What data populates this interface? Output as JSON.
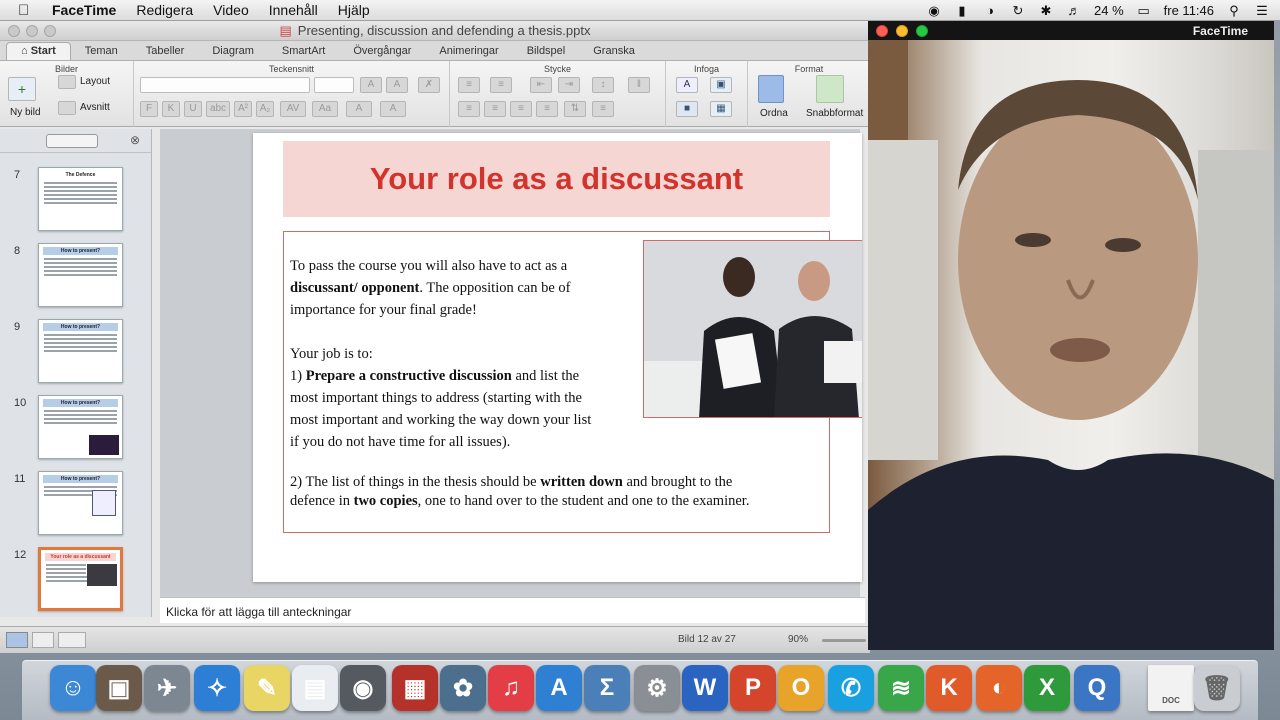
{
  "menubar": {
    "app_name": "FaceTime",
    "items": [
      "Redigera",
      "Video",
      "Innehåll",
      "Hjälp"
    ],
    "battery": "24 %",
    "clock": "fre 11:46"
  },
  "ppt": {
    "window_title": "Presenting, discussion and defending a thesis.pptx",
    "tabs": [
      "Start",
      "Teman",
      "Tabeller",
      "Diagram",
      "SmartArt",
      "Övergångar",
      "Animeringar",
      "Bildspel",
      "Granska"
    ],
    "ribbon": {
      "groups": [
        "Bilder",
        "Teckensnitt",
        "Stycke",
        "Infoga",
        "Format"
      ],
      "new_slide": "Ny bild",
      "layout": "Layout",
      "section": "Avsnitt",
      "arrange": "Ordna",
      "quick_styles": "Snabbformat"
    },
    "thumbnails": [
      {
        "num": "7",
        "title": "The Defence"
      },
      {
        "num": "8",
        "title": "How to present?"
      },
      {
        "num": "9",
        "title": "How to present?"
      },
      {
        "num": "10",
        "title": "How to present?"
      },
      {
        "num": "11",
        "title": "How to present?"
      },
      {
        "num": "12",
        "title": "Your role as a discussant"
      }
    ],
    "slide": {
      "title": "Your role as a discussant",
      "p1_a": "To pass the course you will also have to act as a",
      "p1_b": "discussant/ opponent",
      "p1_c": ". The opposition can be of",
      "p1_d": "importance for your final grade!",
      "p2": "Your job is to:",
      "p3_a": "1) ",
      "p3_b": "Prepare a constructive discussion",
      "p3_c": " and list the",
      "p3_d": "most important things to address (starting with the",
      "p3_e": "most important and working the way down your list",
      "p3_f": "if you do not have time for all issues).",
      "p4_a": "2) The list of things in the thesis should be ",
      "p4_b": "written down",
      "p4_c": " and brought to the",
      "p4_d": "defence in ",
      "p4_e": "two copies",
      "p4_f": ", one to hand over to the student and one to the examiner."
    },
    "notes_placeholder": "Klicka för att lägga till anteckningar",
    "status_slide": "Bild 12 av 27",
    "zoom": "90%"
  },
  "facetime": {
    "title": "FaceTime"
  },
  "dock": {
    "icons": [
      "finder-icon",
      "photo-icon",
      "launchpad-icon",
      "safari-icon",
      "stickies-icon",
      "preview-icon",
      "facetime-icon",
      "photobooth-icon",
      "iphoto-icon",
      "itunes-icon",
      "appstore-icon",
      "calculator-icon",
      "systemprefs-icon",
      "word-icon",
      "powerpoint-icon",
      "outlook-icon",
      "skype-icon",
      "spotify-icon",
      "keynote-icon",
      "firefox-icon",
      "excel-icon",
      "quicktime-icon",
      "document-icon",
      "trash-icon"
    ],
    "doc_label": "DOC"
  }
}
